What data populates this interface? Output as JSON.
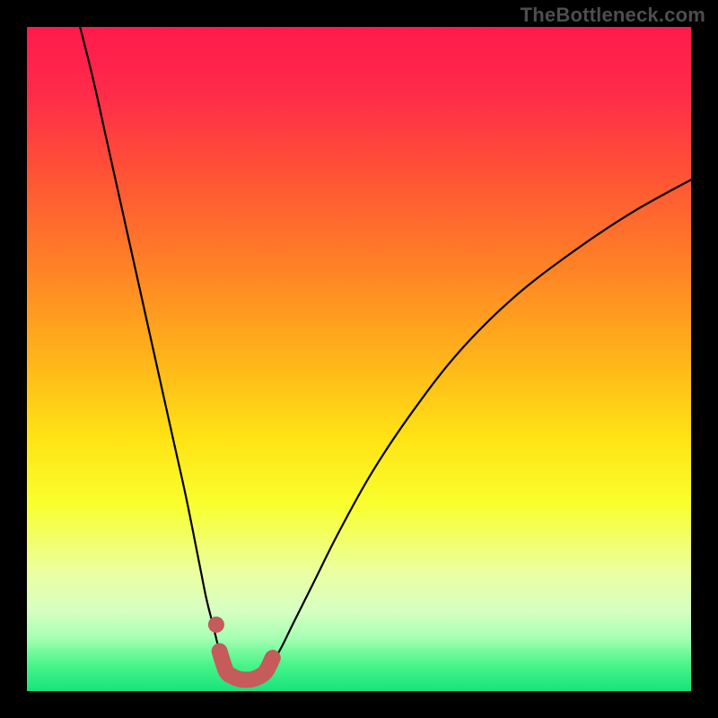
{
  "watermark": "TheBottleneck.com",
  "colors": {
    "frame": "#000000",
    "gradient_stops": [
      {
        "offset": 0.0,
        "color": "#ff1a4d"
      },
      {
        "offset": 0.1,
        "color": "#ff2b49"
      },
      {
        "offset": 0.22,
        "color": "#ff5236"
      },
      {
        "offset": 0.35,
        "color": "#ff7e27"
      },
      {
        "offset": 0.5,
        "color": "#ffb41a"
      },
      {
        "offset": 0.62,
        "color": "#ffe315"
      },
      {
        "offset": 0.72,
        "color": "#f9ff2e"
      },
      {
        "offset": 0.82,
        "color": "#ecffa0"
      },
      {
        "offset": 0.88,
        "color": "#d6ffc3"
      },
      {
        "offset": 0.92,
        "color": "#a6ffb4"
      },
      {
        "offset": 0.96,
        "color": "#49f58a"
      },
      {
        "offset": 1.0,
        "color": "#17e37b"
      }
    ],
    "curve": "#000000",
    "marker": "#c55b5b"
  },
  "chart_data": {
    "type": "line",
    "title": "",
    "xlabel": "",
    "ylabel": "",
    "xlim": [
      0,
      100
    ],
    "ylim": [
      0,
      100
    ],
    "series": [
      {
        "name": "left-curve",
        "x": [
          8,
          10,
          12,
          14,
          16,
          18,
          20,
          22,
          24,
          26,
          27,
          28,
          29,
          30
        ],
        "y": [
          100,
          92,
          83,
          74,
          65,
          56,
          47,
          38,
          29,
          19,
          14,
          10,
          6,
          3
        ]
      },
      {
        "name": "right-curve",
        "x": [
          36,
          38,
          40,
          43,
          47,
          52,
          58,
          65,
          73,
          82,
          91,
          100
        ],
        "y": [
          3,
          6,
          10,
          16,
          24,
          33,
          42,
          51,
          59,
          66,
          72,
          77
        ]
      },
      {
        "name": "bottom-flat",
        "x": [
          30,
          31,
          32,
          33,
          34,
          35,
          36
        ],
        "y": [
          3,
          2.2,
          1.8,
          1.7,
          1.8,
          2.2,
          3
        ]
      }
    ],
    "markers": [
      {
        "name": "left-dot",
        "x": 28.5,
        "y": 10,
        "r": 1.2
      },
      {
        "name": "bottom-trace",
        "path": true
      }
    ]
  }
}
